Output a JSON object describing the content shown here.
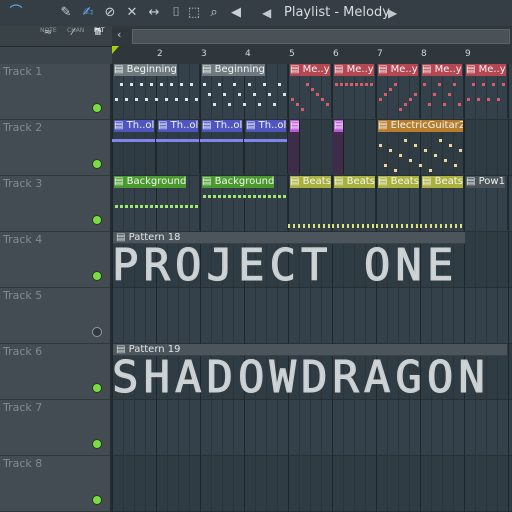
{
  "toolbar": {
    "title": "Playlist - Melody",
    "icons": [
      "magnet-icon",
      "draw-icon",
      "paint-icon",
      "delete-icon",
      "mute-icon",
      "slip-icon",
      "select-icon",
      "zoom-icon",
      "playback-icon"
    ],
    "left_arrow": "◀",
    "right_arrow": "▶"
  },
  "subbar": {
    "note_label": "NOTE",
    "chan_label": "CHAN",
    "pat_label": "PAT"
  },
  "ruler": [
    "2",
    "3",
    "4",
    "5",
    "6",
    "7",
    "8",
    "9"
  ],
  "tracks": [
    {
      "name": "Track 1",
      "led": "on"
    },
    {
      "name": "Track 2",
      "led": "on"
    },
    {
      "name": "Track 3",
      "led": "on"
    },
    {
      "name": "Track 4",
      "led": "on"
    },
    {
      "name": "Track 5",
      "led": "off"
    },
    {
      "name": "Track 6",
      "led": "on"
    },
    {
      "name": "Track 7",
      "led": "on"
    },
    {
      "name": "Track 8",
      "led": "on"
    }
  ],
  "clips": {
    "track1": [
      {
        "label": "Beginning",
        "color": "#6e7a7f"
      },
      {
        "label": "Beginning",
        "color": "#6e7a7f"
      },
      {
        "label": "Me..y",
        "color": "#b54753"
      },
      {
        "label": "Me..y",
        "color": "#b54753"
      },
      {
        "label": "Me..y",
        "color": "#b54753"
      },
      {
        "label": "Me..y",
        "color": "#b54753"
      },
      {
        "label": "Me..y",
        "color": "#b54753"
      }
    ],
    "track2": [
      {
        "label": "Th..ol",
        "color": "#4f56bf"
      },
      {
        "label": "Th..ol",
        "color": "#4f56bf"
      },
      {
        "label": "Th..ol",
        "color": "#4f56bf"
      },
      {
        "label": "Th..ol",
        "color": "#4f56bf"
      },
      {
        "label": "ElectricGuitar2",
        "color": "#b67d2d"
      }
    ],
    "track3": [
      {
        "label": "Background",
        "color": "#4a9a2e"
      },
      {
        "label": "Background",
        "color": "#4a9a2e"
      },
      {
        "label": "Beats",
        "color": "#a9b03b"
      },
      {
        "label": "Beats",
        "color": "#a9b03b"
      },
      {
        "label": "Beats",
        "color": "#a9b03b"
      },
      {
        "label": "Beats",
        "color": "#a9b03b"
      },
      {
        "label": "Pow1",
        "color": "#4a5358"
      }
    ]
  },
  "patterns": [
    {
      "label": "Pattern 18",
      "text": "PROJECT ONE"
    },
    {
      "label": "Pattern 19",
      "text": "SHADOWDRAGON"
    }
  ]
}
